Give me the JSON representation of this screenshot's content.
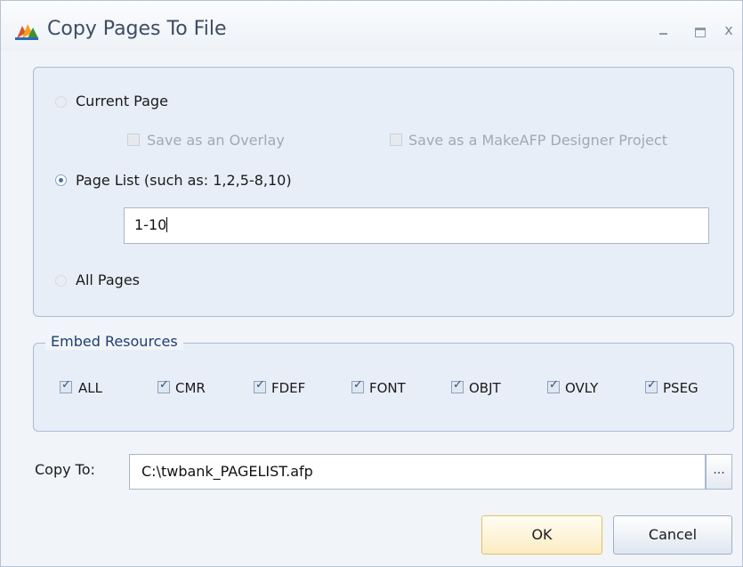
{
  "window": {
    "title": "Copy Pages To File",
    "controls": {
      "minimize": "–",
      "maximize": "□",
      "close": "x"
    }
  },
  "scope": {
    "current_page": {
      "label": "Current Page",
      "selected": false
    },
    "save_overlay": {
      "label": "Save as an Overlay",
      "enabled": false,
      "checked": false
    },
    "save_project": {
      "label": "Save as a MakeAFP Designer Project",
      "enabled": false,
      "checked": false
    },
    "page_list": {
      "label": "Page List (such as: 1,2,5-8,10)",
      "selected": true,
      "value": "1-10"
    },
    "all_pages": {
      "label": "All Pages",
      "selected": false
    }
  },
  "embed_resources": {
    "legend": "Embed Resources",
    "items": [
      {
        "label": "ALL",
        "checked": true
      },
      {
        "label": "CMR",
        "checked": true
      },
      {
        "label": "FDEF",
        "checked": true
      },
      {
        "label": "FONT",
        "checked": true
      },
      {
        "label": "OBJT",
        "checked": true
      },
      {
        "label": "OVLY",
        "checked": true
      },
      {
        "label": "PSEG",
        "checked": true
      }
    ]
  },
  "copy_to": {
    "label": "Copy To:",
    "value": "C:\\twbank_PAGELIST.afp",
    "browse_label": "..."
  },
  "buttons": {
    "ok": "OK",
    "cancel": "Cancel"
  },
  "colors": {
    "group_border": "#a9bcd8",
    "legend_text": "#1e3f73",
    "ok_border": "#e3bf65"
  }
}
